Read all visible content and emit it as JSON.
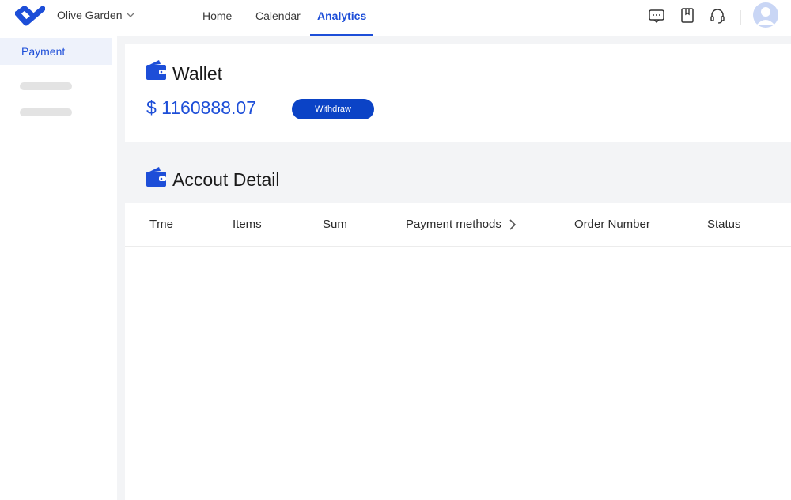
{
  "colors": {
    "accent": "#1d4ed8",
    "button": "#0b43c6",
    "background": "#f3f4f6",
    "surface": "#ffffff"
  },
  "header": {
    "org_name": "Olive Garden",
    "nav": [
      "Home",
      "Calendar",
      "Analytics"
    ],
    "active_nav": "Analytics",
    "icons": [
      "message-icon",
      "bookmark-icon",
      "headset-icon",
      "user-avatar"
    ]
  },
  "sidebar": {
    "active_item": "Payment"
  },
  "wallet": {
    "title": "Wallet",
    "balance": "$ 1160888.07",
    "withdraw_label": "Withdraw"
  },
  "account_detail": {
    "title": "Accout Detail",
    "columns": [
      "Tme",
      "Items",
      "Sum",
      "Payment methods",
      "Order Number",
      "Status"
    ],
    "rows": []
  }
}
